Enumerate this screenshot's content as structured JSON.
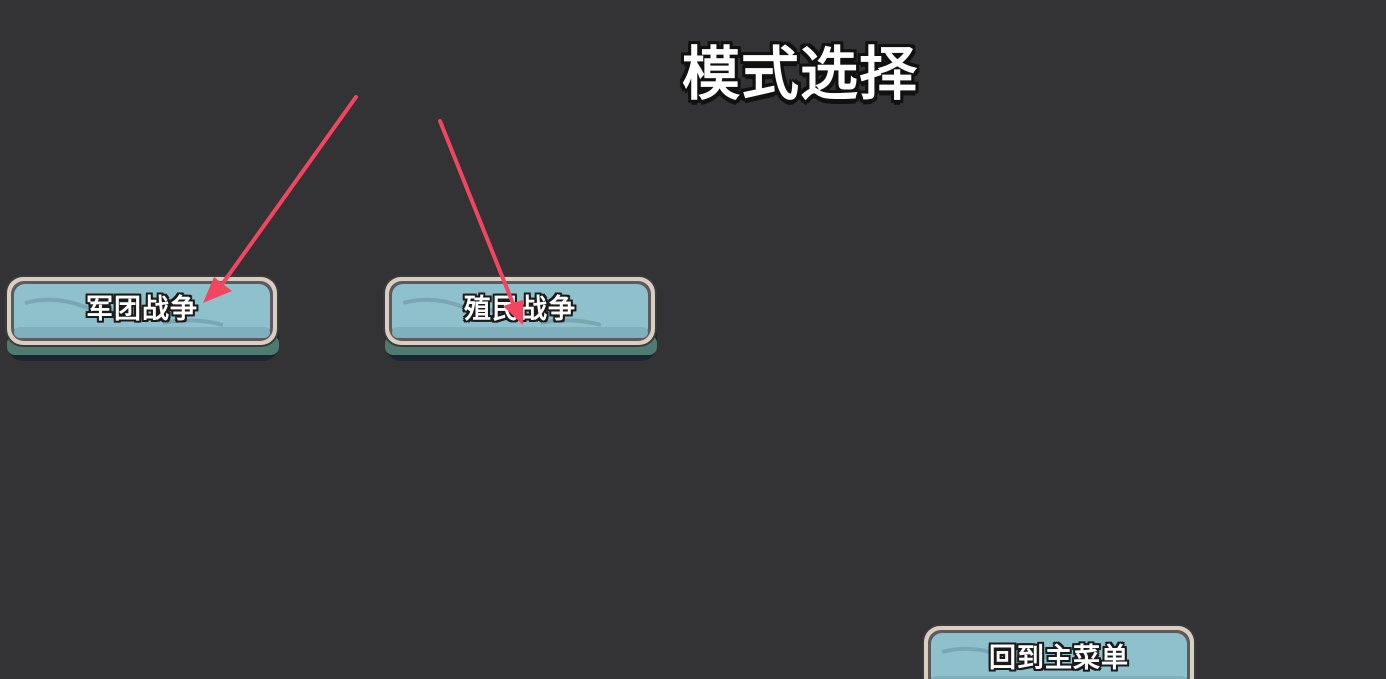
{
  "screen": {
    "title": "模式选择"
  },
  "buttons": {
    "legion_war": "军团战争",
    "colony_war": "殖民战争",
    "back_to_main": "回到主菜单"
  },
  "colors": {
    "background": "#333235",
    "button_fill": "#8fc1cc",
    "button_frame": "#d9cfbf",
    "arrow": "#f2455f"
  }
}
